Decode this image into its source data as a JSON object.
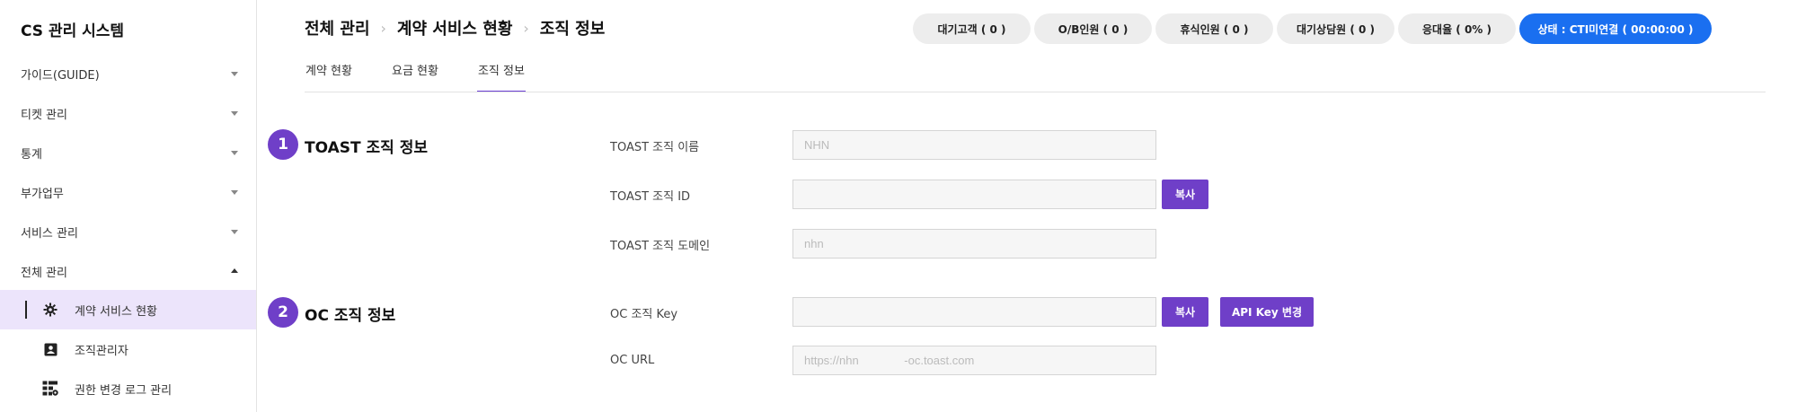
{
  "app": {
    "title": "CS 관리 시스템"
  },
  "sidebar": {
    "menu": [
      {
        "label": "가이드(GUIDE)",
        "expanded": false
      },
      {
        "label": "티켓 관리",
        "expanded": false
      },
      {
        "label": "통계",
        "expanded": false
      },
      {
        "label": "부가업무",
        "expanded": false
      },
      {
        "label": "서비스 관리",
        "expanded": false
      },
      {
        "label": "전체 관리",
        "expanded": true
      }
    ],
    "sub_items": [
      {
        "label": "계약 서비스 현황",
        "icon": "gear-icon",
        "active": true
      },
      {
        "label": "조직관리자",
        "icon": "contact-card-icon",
        "active": false
      },
      {
        "label": "권한 변경 로그 관리",
        "icon": "log-settings-icon",
        "active": false
      }
    ]
  },
  "header": {
    "breadcrumb": [
      "전체 관리",
      "계약 서비스 현황",
      "조직 정보"
    ],
    "pills": [
      {
        "label": "대기고객 ( 0 )"
      },
      {
        "label": "O/B인원 ( 0 )"
      },
      {
        "label": "휴식인원 ( 0 )"
      },
      {
        "label": "대기상담원 ( 0 )"
      },
      {
        "label": "응대율 ( 0% )"
      }
    ],
    "status": {
      "label": "상태 : CTI미연결 ( 00:00:00 )",
      "color": "#1a6ff0"
    }
  },
  "tabs": [
    {
      "label": "계약 현황",
      "active": false
    },
    {
      "label": "요금 현황",
      "active": false
    },
    {
      "label": "조직 정보",
      "active": true
    }
  ],
  "sections": {
    "toast": {
      "number": "1",
      "title": "TOAST 조직 정보",
      "fields": [
        {
          "label": "TOAST 조직 이름",
          "value": "NHN"
        },
        {
          "label": "TOAST 조직 ID",
          "value": "",
          "copy_label": "복사"
        },
        {
          "label": "TOAST 조직 도메인",
          "value": "nhn"
        }
      ]
    },
    "oc": {
      "number": "2",
      "title": "OC 조직 정보",
      "fields": [
        {
          "label": "OC 조직 Key",
          "value": "",
          "copy_label": "복사",
          "change_label": "API Key 변경"
        },
        {
          "label": "OC URL",
          "value": "https://nhn              -oc.toast.com"
        }
      ]
    }
  },
  "colors": {
    "accent": "#6f3fc8",
    "active_bg": "#ece4fb",
    "status_blue": "#1a6ff0"
  }
}
